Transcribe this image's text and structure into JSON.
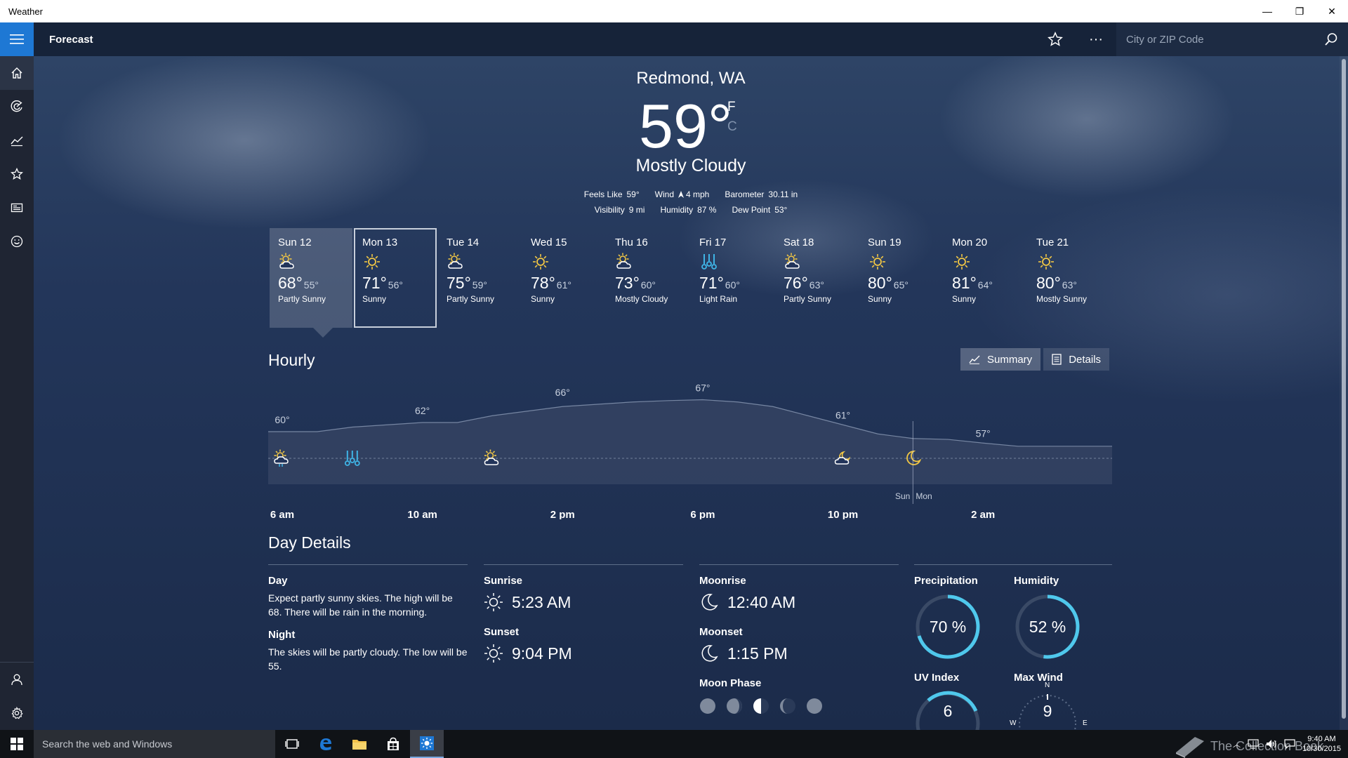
{
  "window": {
    "title": "Weather",
    "minimize": "—",
    "restore": "❐",
    "close": "✕"
  },
  "header": {
    "section": "Forecast",
    "search_placeholder": "City or ZIP Code",
    "more": "···"
  },
  "current": {
    "location": "Redmond, WA",
    "temp": "59°",
    "unit_f": "F",
    "unit_c": "C",
    "condition": "Mostly Cloudy",
    "feels_like_label": "Feels Like",
    "feels_like": "59°",
    "wind_label": "Wind",
    "wind": "4 mph",
    "barometer_label": "Barometer",
    "barometer": "30.11 in",
    "visibility_label": "Visibility",
    "visibility": "9 mi",
    "humidity_label": "Humidity",
    "humidity": "87 %",
    "dewpoint_label": "Dew Point",
    "dewpoint": "53°"
  },
  "days": [
    {
      "name": "Sun 12",
      "hi": "68°",
      "lo": "55°",
      "cond": "Partly Sunny",
      "icon": "partly-sunny-icon"
    },
    {
      "name": "Mon 13",
      "hi": "71°",
      "lo": "56°",
      "cond": "Sunny",
      "icon": "sunny-icon"
    },
    {
      "name": "Tue 14",
      "hi": "75°",
      "lo": "59°",
      "cond": "Partly Sunny",
      "icon": "partly-sunny-icon"
    },
    {
      "name": "Wed 15",
      "hi": "78°",
      "lo": "61°",
      "cond": "Sunny",
      "icon": "sunny-icon"
    },
    {
      "name": "Thu 16",
      "hi": "73°",
      "lo": "60°",
      "cond": "Mostly Cloudy",
      "icon": "partly-sunny-icon"
    },
    {
      "name": "Fri 17",
      "hi": "71°",
      "lo": "60°",
      "cond": "Light Rain",
      "icon": "rain-icon"
    },
    {
      "name": "Sat 18",
      "hi": "76°",
      "lo": "63°",
      "cond": "Partly Sunny",
      "icon": "partly-sunny-icon"
    },
    {
      "name": "Sun 19",
      "hi": "80°",
      "lo": "65°",
      "cond": "Sunny",
      "icon": "sunny-icon"
    },
    {
      "name": "Mon 20",
      "hi": "81°",
      "lo": "64°",
      "cond": "Sunny",
      "icon": "sunny-icon"
    },
    {
      "name": "Tue 21",
      "hi": "80°",
      "lo": "63°",
      "cond": "Mostly Sunny",
      "icon": "sunny-icon"
    }
  ],
  "hourly": {
    "title": "Hourly",
    "summary_label": "Summary",
    "details_label": "Details",
    "temp_labels": [
      {
        "hour": 0,
        "temp": 60,
        "text": "60°"
      },
      {
        "hour": 4,
        "temp": 62,
        "text": "62°"
      },
      {
        "hour": 8,
        "temp": 66,
        "text": "66°"
      },
      {
        "hour": 12,
        "temp": 67,
        "text": "67°"
      },
      {
        "hour": 16,
        "temp": 61,
        "text": "61°"
      },
      {
        "hour": 20,
        "temp": 57,
        "text": "57°"
      }
    ],
    "curve": [
      {
        "hour": 0,
        "temp": 60
      },
      {
        "hour": 1,
        "temp": 60
      },
      {
        "hour": 2,
        "temp": 61
      },
      {
        "hour": 3,
        "temp": 61.5
      },
      {
        "hour": 4,
        "temp": 62
      },
      {
        "hour": 5,
        "temp": 62
      },
      {
        "hour": 6,
        "temp": 63.5
      },
      {
        "hour": 7,
        "temp": 64.5
      },
      {
        "hour": 8,
        "temp": 65.5
      },
      {
        "hour": 9,
        "temp": 66
      },
      {
        "hour": 10,
        "temp": 66.5
      },
      {
        "hour": 11,
        "temp": 66.8
      },
      {
        "hour": 12,
        "temp": 67
      },
      {
        "hour": 13,
        "temp": 66.5
      },
      {
        "hour": 14,
        "temp": 65.5
      },
      {
        "hour": 15,
        "temp": 63.5
      },
      {
        "hour": 16,
        "temp": 61.5
      },
      {
        "hour": 17,
        "temp": 59.5
      },
      {
        "hour": 18,
        "temp": 58.5
      },
      {
        "hour": 19,
        "temp": 58.3
      },
      {
        "hour": 20,
        "temp": 57.5
      },
      {
        "hour": 21,
        "temp": 56.8
      },
      {
        "hour": 22,
        "temp": 56.8
      }
    ],
    "time_labels": [
      {
        "hour": 0,
        "text": "6 am"
      },
      {
        "hour": 4,
        "text": "10 am"
      },
      {
        "hour": 8,
        "text": "2 pm"
      },
      {
        "hour": 12,
        "text": "6 pm"
      },
      {
        "hour": 16,
        "text": "10 pm"
      },
      {
        "hour": 20,
        "text": "2 am"
      }
    ],
    "icons": [
      {
        "hour": 0,
        "name": "partly-sunny-rain-icon"
      },
      {
        "hour": 2,
        "name": "rain-icon"
      },
      {
        "hour": 6,
        "name": "partly-sunny-icon"
      },
      {
        "hour": 16,
        "name": "partly-cloudy-night-icon"
      },
      {
        "hour": 18,
        "name": "moon-icon"
      }
    ],
    "day_divider_hour": 18,
    "day_prev": "Sun",
    "day_next": "Mon"
  },
  "day_details": {
    "title": "Day Details",
    "day_label": "Day",
    "day_text": "Expect partly sunny skies. The high will be 68. There will be rain in the morning.",
    "night_label": "Night",
    "night_text": "The skies will be partly cloudy. The low will be 55.",
    "sunrise_label": "Sunrise",
    "sunrise": "5:23 AM",
    "sunset_label": "Sunset",
    "sunset": "9:04 PM",
    "moonrise_label": "Moonrise",
    "moonrise": "12:40 AM",
    "moonset_label": "Moonset",
    "moonset": "1:15 PM",
    "moonphase_label": "Moon Phase",
    "precip_label": "Precipitation",
    "precip": "70 %",
    "precip_fraction": 0.7,
    "humidity_label": "Humidity",
    "humidity": "52 %",
    "humidity_fraction": 0.52,
    "uv_label": "UV Index",
    "uv": "6",
    "wind_label": "Max Wind",
    "wind": "9",
    "compass_n": "N",
    "compass_w": "W",
    "compass_e": "E"
  },
  "taskbar": {
    "search_placeholder": "Search the web and Windows",
    "time": "9:40 AM",
    "date": "10/30/2015",
    "watermark": "The Collection Book"
  },
  "colors": {
    "accent": "#1e78d4",
    "ring": "#4fc8ec",
    "sun": "#f2c744",
    "rain": "#3fb4e6"
  }
}
